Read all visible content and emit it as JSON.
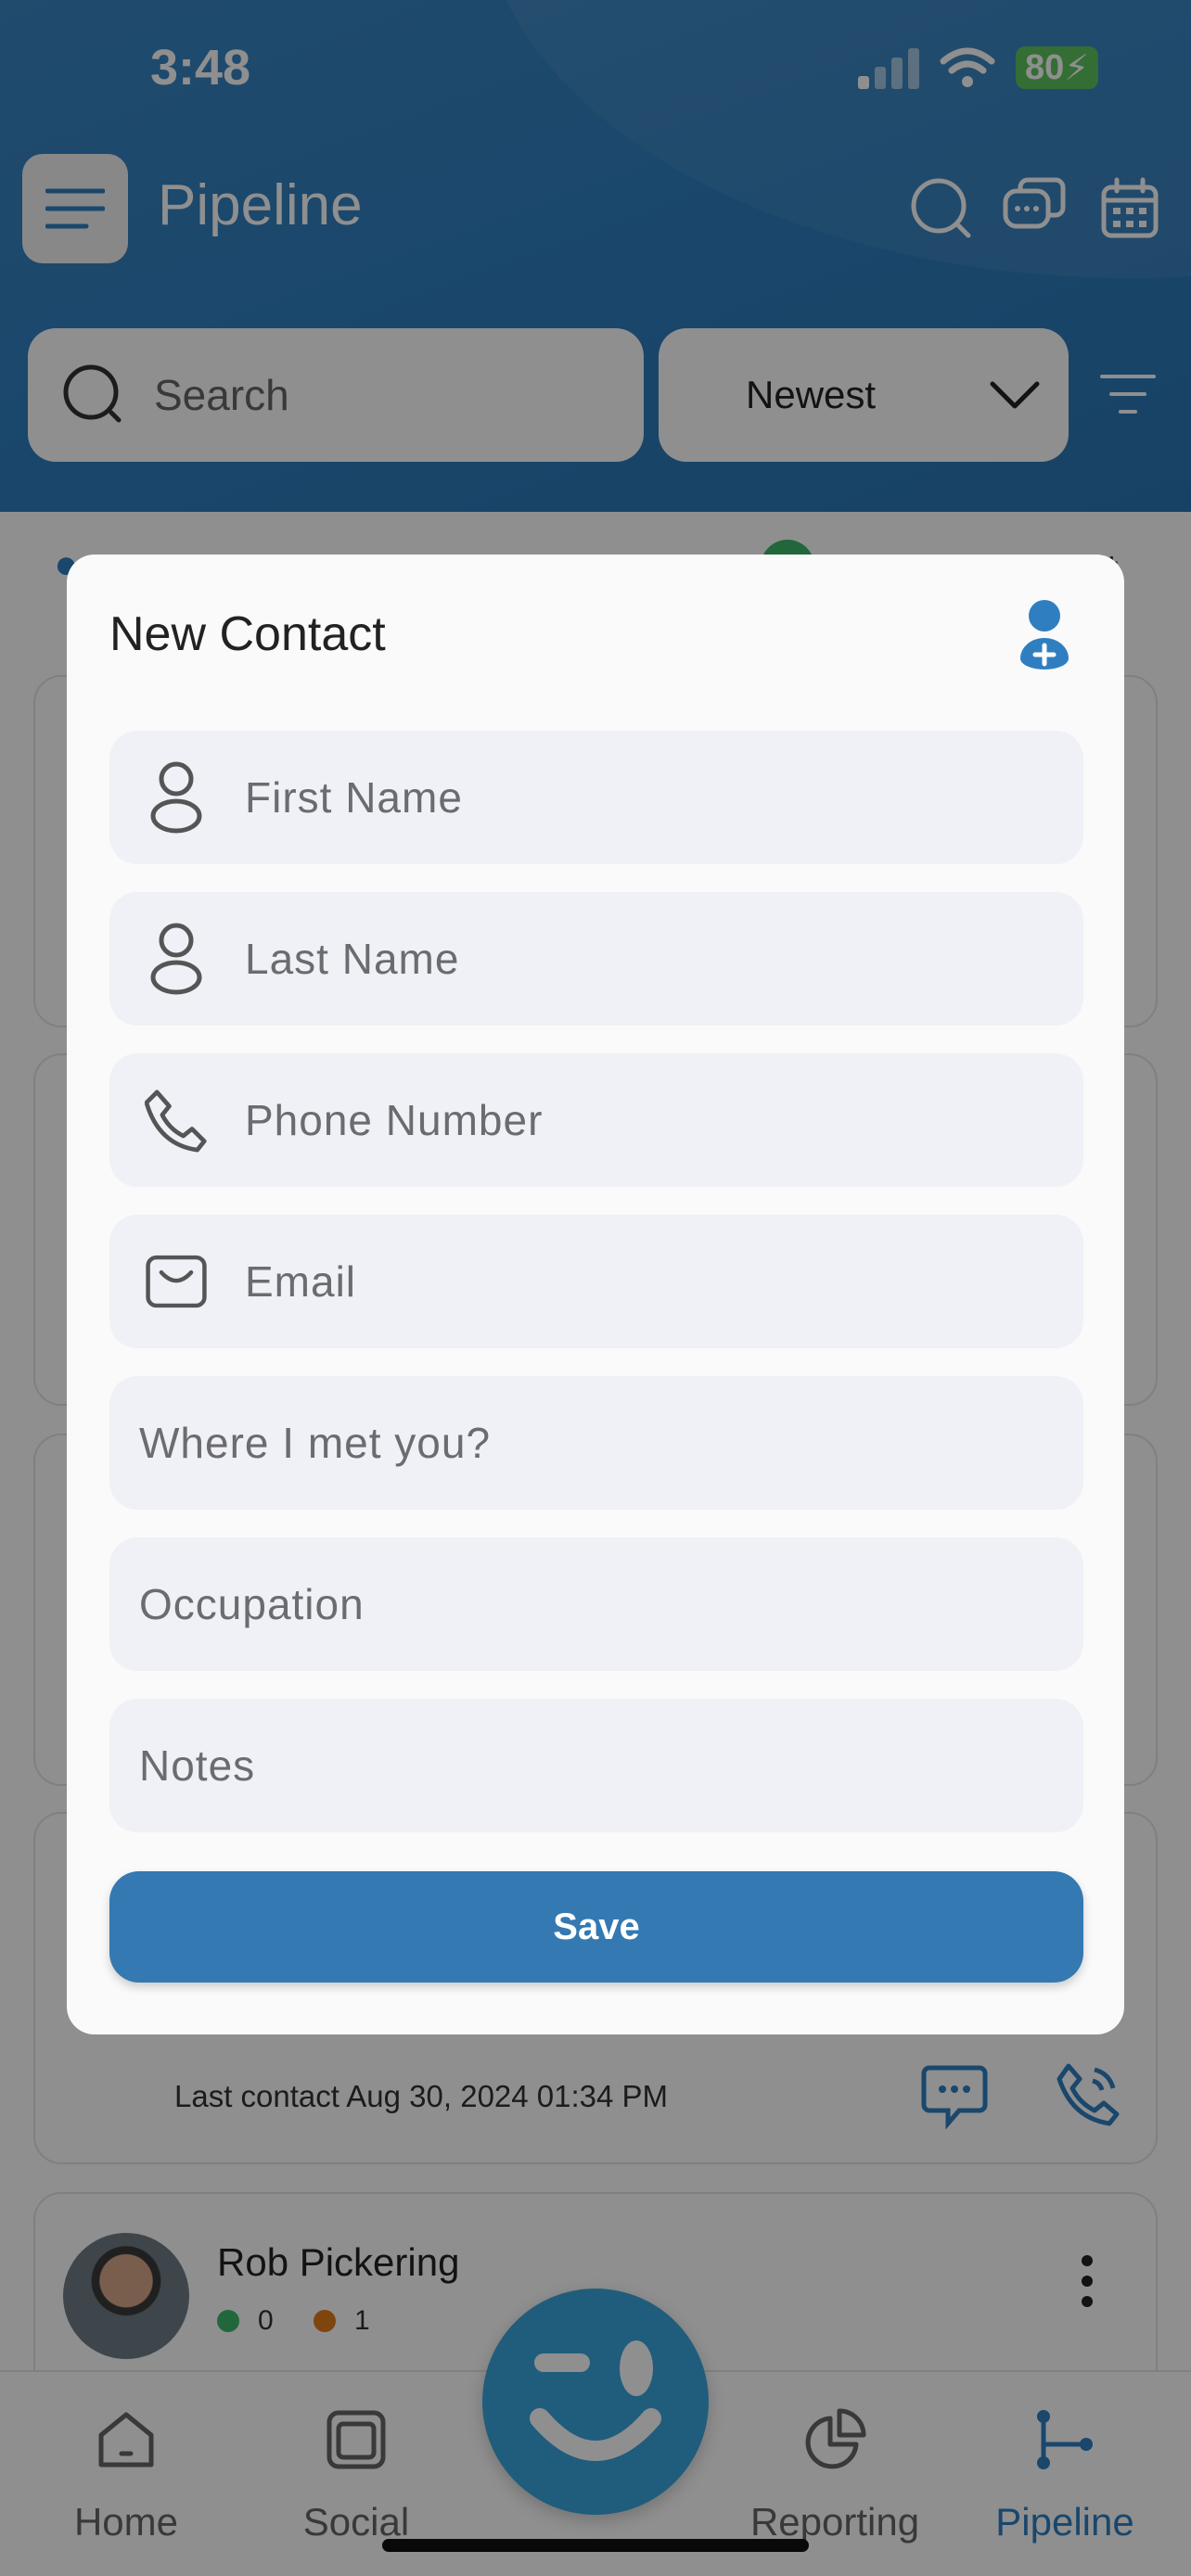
{
  "status_bar": {
    "time": "3:48",
    "battery": "80"
  },
  "header": {
    "title": "Pipeline",
    "search_placeholder": "Search",
    "sort_selected": "Newest"
  },
  "list": {
    "last_contact": "Last contact Aug 30, 2024 01:34 PM",
    "contact": {
      "name": "Rob Pickering",
      "green_count": "0",
      "orange_count": "1"
    }
  },
  "tabbar": {
    "tabs": [
      {
        "label": "Home",
        "icon": "home-icon"
      },
      {
        "label": "Social",
        "icon": "social-icon"
      },
      {
        "label": "Reporting",
        "icon": "reporting-icon"
      },
      {
        "label": "Pipeline",
        "icon": "pipeline-icon"
      }
    ],
    "active": "Pipeline"
  },
  "modal": {
    "title": "New Contact",
    "fields": {
      "first_name": "First Name",
      "last_name": "Last Name",
      "phone": "Phone Number",
      "email": "Email",
      "where_met": "Where I met you?",
      "occupation": "Occupation",
      "notes": "Notes"
    },
    "save_label": "Save"
  },
  "colors": {
    "brand_blue": "#2f7fc0",
    "save_blue": "#3479b1",
    "field_bg": "#eff1f7",
    "battery_green": "#5ec45e"
  }
}
